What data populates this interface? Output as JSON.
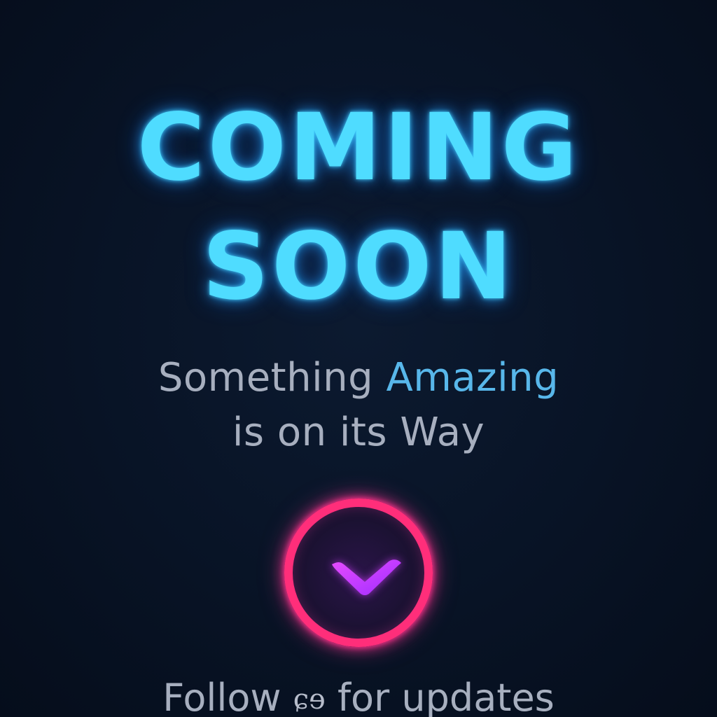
{
  "hero": {
    "title_line_1": "COMING",
    "title_line_2": "SOON"
  },
  "subtitle": {
    "line_1_start": "Something ",
    "line_1_accent": "Amazing",
    "line_2": "is on its Way"
  },
  "cta": {
    "icon": "chevron-down-icon"
  },
  "footer": {
    "prefix": "Follow ",
    "handle": "ɕɘ",
    "suffix": " for updates"
  },
  "colors": {
    "background": "#081325",
    "title": "#4fdcff",
    "subtitle": "#a7afbf",
    "accent": "#58b7ea",
    "ring": "#ff2e7a",
    "chevron": "#c93bff"
  }
}
